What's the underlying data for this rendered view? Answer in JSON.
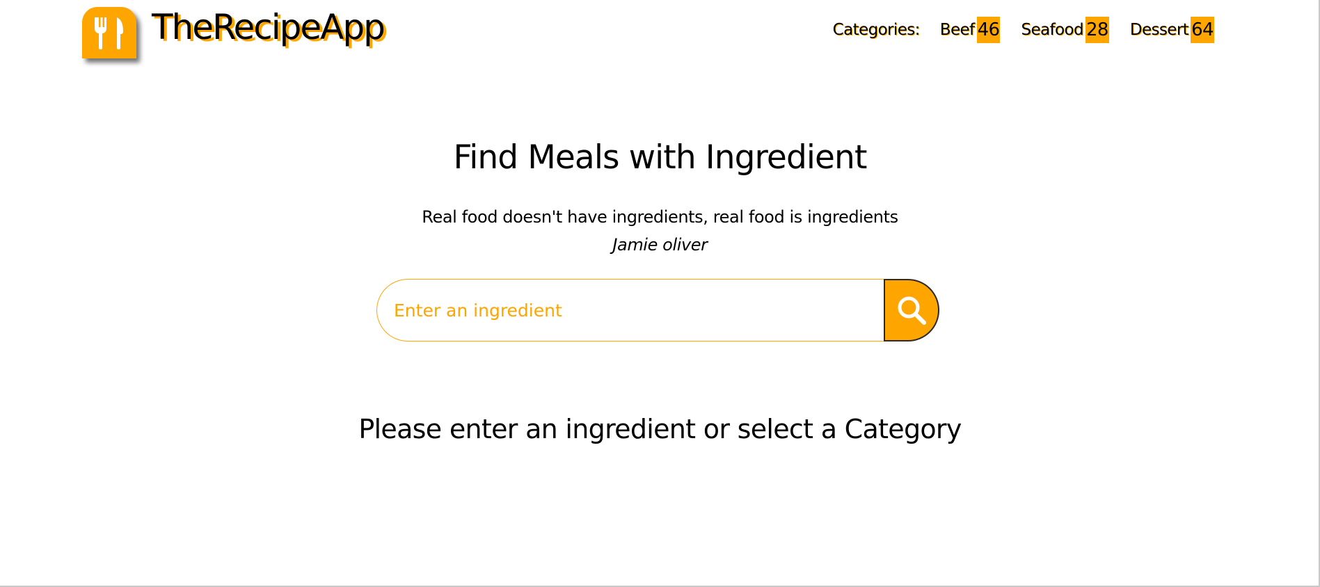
{
  "brand": {
    "name": "TheRecipeApp",
    "logo_icon": "fork-knife-icon"
  },
  "nav": {
    "label": "Categories:",
    "categories": [
      {
        "name": "Beef",
        "count": "46"
      },
      {
        "name": "Seafood",
        "count": "28"
      },
      {
        "name": "Dessert",
        "count": "64"
      }
    ]
  },
  "main": {
    "title": "Find Meals with Ingredient",
    "quote": "Real food doesn't have ingredients, real food is ingredients",
    "author": "Jamie oliver",
    "search": {
      "placeholder": "Enter an ingredient",
      "value": "",
      "button_icon": "search-icon"
    },
    "message": "Please enter an ingredient or select a Category"
  },
  "colors": {
    "accent": "#ffa500",
    "text": "#000000",
    "background": "#ffffff"
  }
}
